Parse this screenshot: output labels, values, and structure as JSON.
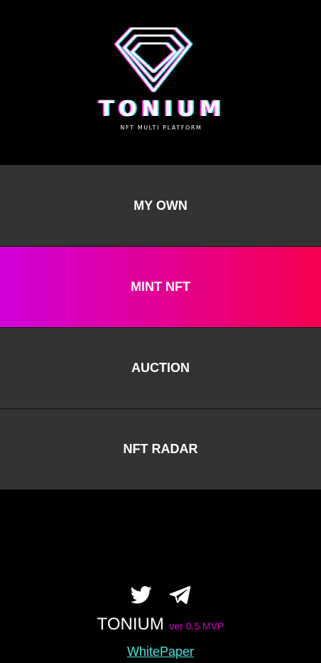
{
  "logo": {
    "title": "TONIUM",
    "subtitle": "NFT MULTI PLATFORM",
    "icon": "diamond-logo-icon",
    "colors": {
      "main": "#ffffff",
      "glitch_left": "#ff2bd6",
      "glitch_right": "#35e6f2"
    }
  },
  "menu": {
    "items": [
      {
        "label": "MY OWN",
        "active": false
      },
      {
        "label": "MINT NFT",
        "active": true
      },
      {
        "label": "AUCTION",
        "active": false
      },
      {
        "label": "NFT RADAR",
        "active": false
      }
    ],
    "colors": {
      "item_bg": "#333333",
      "active_gradient_start": "#d000d8",
      "active_gradient_end": "#f5004f"
    }
  },
  "footer": {
    "social": [
      {
        "icon": "twitter-icon"
      },
      {
        "icon": "telegram-icon"
      }
    ],
    "brand": "TONIUM",
    "version": "ver 0.5 MVP",
    "whitepaper_label": "WhitePaper",
    "colors": {
      "version": "#d400c8",
      "link": "#4ee6d8"
    }
  }
}
